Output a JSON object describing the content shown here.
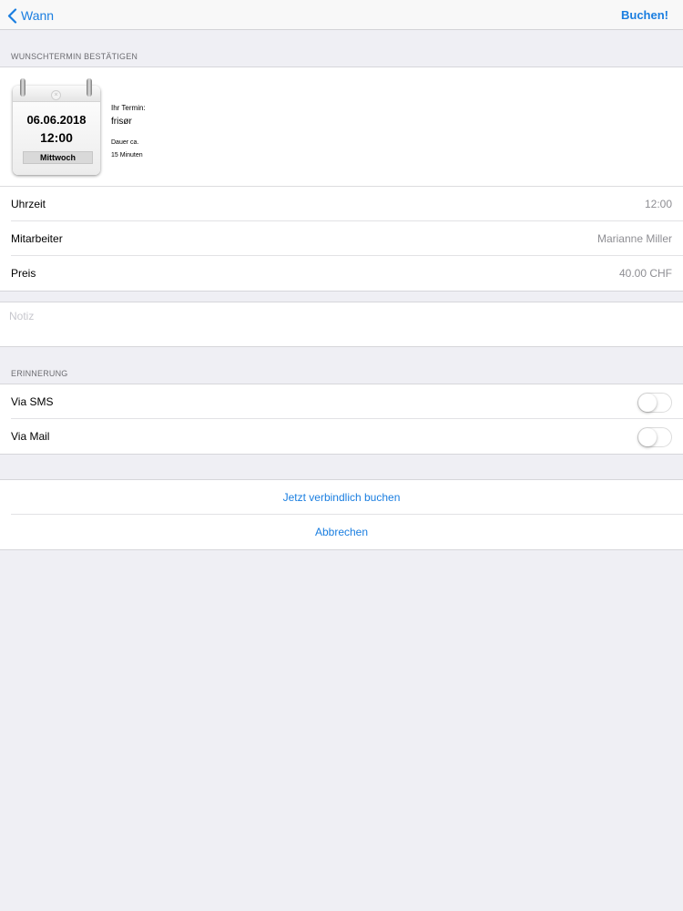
{
  "nav": {
    "back_label": "Wann",
    "action_label": "Buchen!"
  },
  "confirm_section": {
    "header": "WUNSCHTERMIN BESTÄTIGEN",
    "calendar": {
      "date": "06.06.2018",
      "time": "12:00",
      "weekday": "Mittwoch"
    },
    "appointment_label": "Ihr Termin:",
    "service": "frisør",
    "duration_label": "Dauer ca.",
    "duration_value": "15 Minuten",
    "details": [
      {
        "label": "Uhrzeit",
        "value": "12:00"
      },
      {
        "label": "Mitarbeiter",
        "value": "Marianne Miller"
      },
      {
        "label": "Preis",
        "value": "40.00 CHF"
      }
    ]
  },
  "note": {
    "placeholder": "Notiz",
    "value": ""
  },
  "reminder_section": {
    "header": "ERINNERUNG",
    "options": [
      {
        "label": "Via SMS",
        "enabled": false
      },
      {
        "label": "Via Mail",
        "enabled": false
      }
    ]
  },
  "actions": {
    "book_label": "Jetzt verbindlich buchen",
    "cancel_label": "Abbrechen"
  },
  "colors": {
    "accent": "#1a7ee0",
    "background": "#efeff4",
    "secondary_text": "#8e8e93"
  }
}
